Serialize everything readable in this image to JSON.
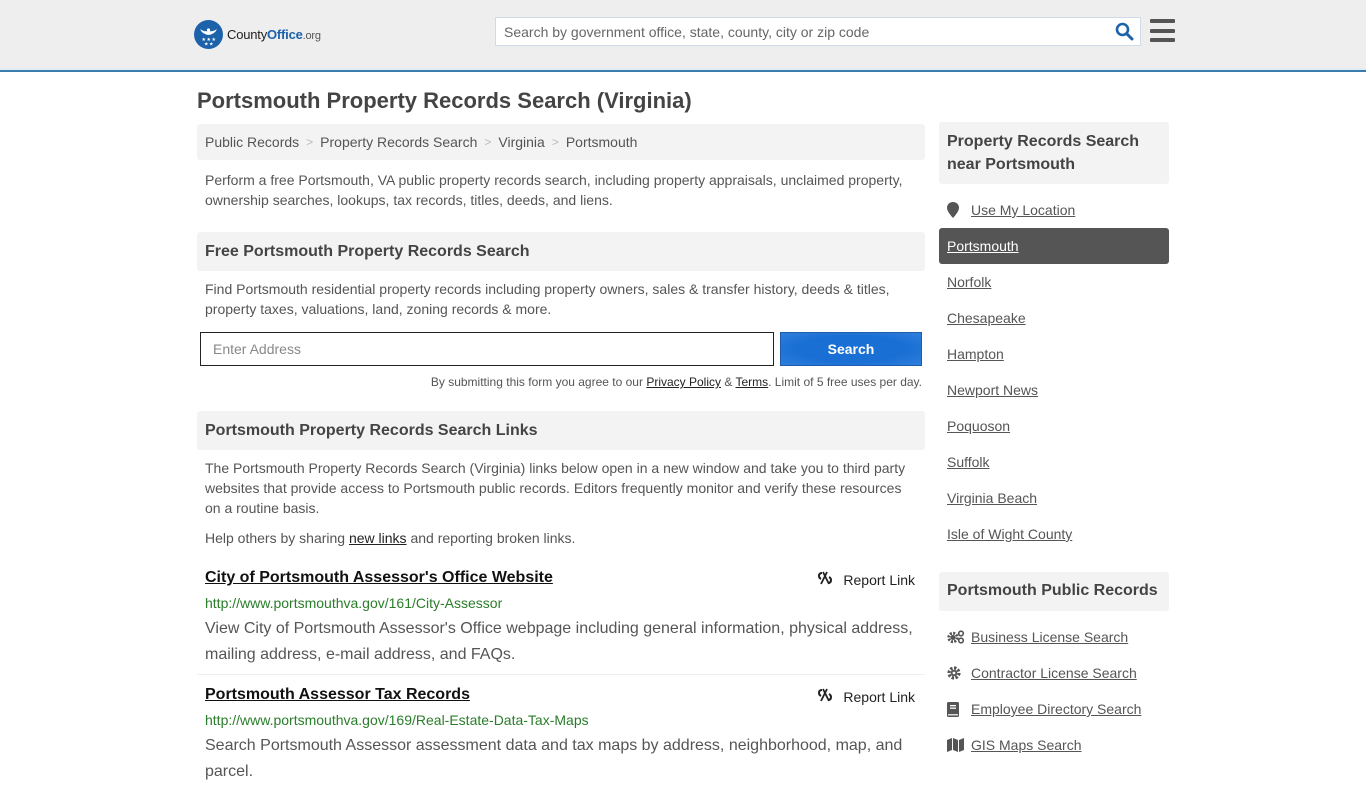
{
  "header": {
    "logo": {
      "name_part1": "County",
      "name_part2": "Office",
      "name_part3": ".org"
    },
    "search_placeholder": "Search by government office, state, county, city or zip code",
    "search_icon": "search-icon",
    "menu_icon": "hamburger-menu-icon"
  },
  "colors": {
    "brand_blue": "#1c62ab",
    "header_border": "#3a7cad",
    "button_blue": "#1a6fd4",
    "url_green": "#2a7d2a",
    "active_item_bg": "#555555"
  },
  "page_title": "Portsmouth Property Records Search (Virginia)",
  "breadcrumb": [
    {
      "label": "Public Records"
    },
    {
      "label": "Property Records Search"
    },
    {
      "label": "Virginia"
    },
    {
      "label": "Portsmouth"
    }
  ],
  "breadcrumb_separator": ">",
  "intro": "Perform a free Portsmouth, VA public property records search, including property appraisals, unclaimed property, ownership searches, lookups, tax records, titles, deeds, and liens.",
  "free_search": {
    "heading": "Free Portsmouth Property Records Search",
    "description": "Find Portsmouth residential property records including property owners, sales & transfer history, deeds & titles, property taxes, valuations, land, zoning records & more.",
    "address_placeholder": "Enter Address",
    "address_value": "",
    "button_label": "Search",
    "terms_prefix": "By submitting this form you agree to our ",
    "privacy_label": "Privacy Policy",
    "terms_amp": " & ",
    "terms_label": "Terms",
    "terms_suffix": ". Limit of 5 free uses per day."
  },
  "links_section": {
    "heading": "Portsmouth Property Records Search Links",
    "description": "The Portsmouth Property Records Search (Virginia) links below open in a new window and take you to third party websites that provide access to Portsmouth public records. Editors frequently monitor and verify these resources on a routine basis.",
    "help_prefix": "Help others by sharing ",
    "help_link": "new links",
    "help_suffix": " and reporting broken links.",
    "report_label": "Report Link",
    "items": [
      {
        "title": "City of Portsmouth Assessor's Office Website",
        "url": "http://www.portsmouthva.gov/161/City-Assessor",
        "description": "View City of Portsmouth Assessor's Office webpage including general information, physical address, mailing address, e-mail address, and FAQs."
      },
      {
        "title": "Portsmouth Assessor Tax Records",
        "url": "http://www.portsmouthva.gov/169/Real-Estate-Data-Tax-Maps",
        "description": "Search Portsmouth Assessor assessment data and tax maps by address, neighborhood, map, and parcel."
      }
    ]
  },
  "sidebar": {
    "nearby_heading": "Property Records Search near Portsmouth",
    "use_location": "Use My Location",
    "nearby": [
      {
        "label": "Portsmouth",
        "active": true
      },
      {
        "label": "Norfolk"
      },
      {
        "label": "Chesapeake"
      },
      {
        "label": "Hampton"
      },
      {
        "label": "Newport News"
      },
      {
        "label": "Poquoson"
      },
      {
        "label": "Suffolk"
      },
      {
        "label": "Virginia Beach"
      },
      {
        "label": "Isle of Wight County"
      }
    ],
    "public_records_heading": "Portsmouth Public Records",
    "public_records": [
      {
        "label": "Business License Search",
        "icon": "gears-icon"
      },
      {
        "label": "Contractor License Search",
        "icon": "gear-icon"
      },
      {
        "label": "Employee Directory Search",
        "icon": "book-icon"
      },
      {
        "label": "GIS Maps Search",
        "icon": "map-icon"
      }
    ]
  }
}
